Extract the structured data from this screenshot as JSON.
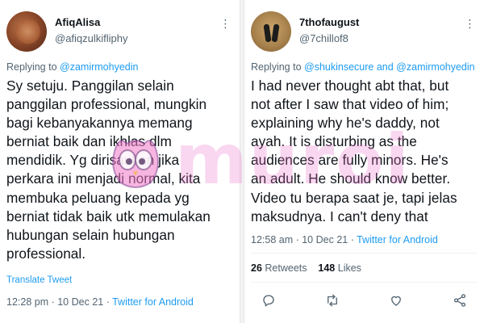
{
  "tweets": [
    {
      "display_name": "AfiqAlisa",
      "handle": "@afiqzulkifliphy",
      "replying_prefix": "Replying to ",
      "mentions": [
        "@zamirmohyedin"
      ],
      "body_lines": [
        "Sy setuju. Panggilan selain",
        "panggilan professional, mungkin",
        "bagi kebanyakannya memang",
        "berniat baik dan ikhlas dlm",
        "mendidik. Yg dirisaukan jika",
        "perkara ini menjadi normal, kita",
        "membuka peluang kepada yg",
        "berniat tidak baik utk memulakan",
        "hubungan selain hubungan",
        "professional."
      ],
      "translate_label": "Translate Tweet",
      "time": "12:28 pm",
      "date": "10 Dec 21",
      "source": "Twitter for Android",
      "avatar_icon": "food-photo-avatar"
    },
    {
      "display_name": "7thofaugust",
      "handle": "@7chillof8",
      "replying_prefix": "Replying to ",
      "mentions": [
        "@shukinsecure",
        "@zamirmohyedin"
      ],
      "mention_joiner": " and ",
      "body_lines": [
        "I had never thought abt that, but",
        "not after I saw that video of him;",
        "explaining why he's daddy, not",
        "ayah. It is disturbing as the",
        "audiences are fully minors. He's",
        "an adult. He should know better.",
        "Video tu berapa saat je, tapi jelas",
        "maksudnya. I can't deny that"
      ],
      "time": "12:58 am",
      "date": "10 Dec 21",
      "source": "Twitter for Android",
      "retweets": "26",
      "retweets_label": "Retweets",
      "likes": "148",
      "likes_label": "Likes",
      "avatar_icon": "feet-photo-avatar",
      "actions": [
        "reply-icon",
        "retweet-icon",
        "like-icon",
        "share-icon"
      ]
    }
  ],
  "watermark": {
    "text": "muroi",
    "color": "#e86ec8"
  },
  "colors": {
    "link": "#1d9bf0",
    "secondary": "#536471",
    "text": "#0f1419"
  },
  "separator": " · "
}
